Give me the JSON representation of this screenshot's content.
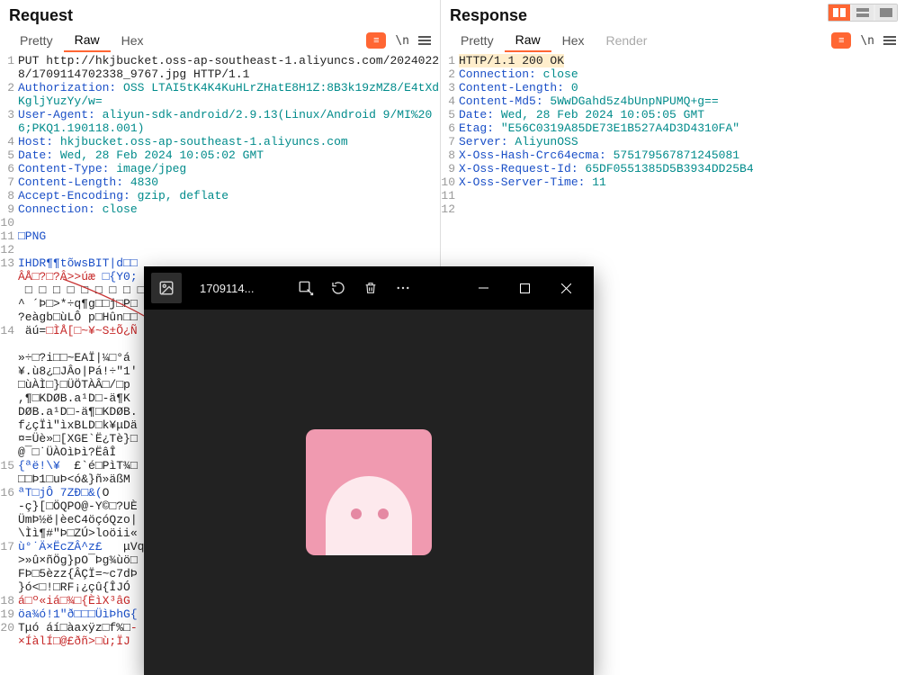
{
  "request": {
    "title": "Request",
    "tabs": {
      "pretty": "Pretty",
      "raw": "Raw",
      "hex": "Hex"
    },
    "nl_icon": "\\n",
    "lines": [
      {
        "n": "1",
        "segs": [
          {
            "t": "PUT ",
            "c": "k-dark"
          },
          {
            "t": "http://hkjbucket.oss-ap-southeast-1.aliyuncs.com/20240228/1709114702338_9767.jpg HTTP/1.1",
            "c": "k-dark",
            "wrap": true
          }
        ]
      },
      {
        "n": "2",
        "segs": [
          {
            "t": "Authorization:",
            "c": "k-blue"
          },
          {
            "t": " OSS LTAI5tK4K4KuHLrZHatE8H1Z:8B3k19zMZ8/E4tXdKgljYuzYy/w=",
            "c": "k-teal",
            "wrap": true
          }
        ]
      },
      {
        "n": "3",
        "segs": [
          {
            "t": "User-Agent:",
            "c": "k-blue"
          },
          {
            "t": " aliyun-sdk-android/2.9.13(Linux/Android 9/MI%206;PKQ1.190118.001)",
            "c": "k-teal",
            "wrap": true
          }
        ]
      },
      {
        "n": "4",
        "segs": [
          {
            "t": "Host:",
            "c": "k-blue"
          },
          {
            "t": " hkjbucket.oss-ap-southeast-1.aliyuncs.com",
            "c": "k-teal"
          }
        ]
      },
      {
        "n": "5",
        "segs": [
          {
            "t": "Date:",
            "c": "k-blue"
          },
          {
            "t": " Wed, 28 Feb 2024 10:05:02 GMT",
            "c": "k-teal"
          }
        ]
      },
      {
        "n": "6",
        "segs": [
          {
            "t": "Content-Type:",
            "c": "k-blue"
          },
          {
            "t": " image/jpeg",
            "c": "k-teal"
          }
        ]
      },
      {
        "n": "7",
        "segs": [
          {
            "t": "Content-Length:",
            "c": "k-blue"
          },
          {
            "t": " 4830",
            "c": "k-teal"
          }
        ]
      },
      {
        "n": "8",
        "segs": [
          {
            "t": "Accept-Encoding:",
            "c": "k-blue"
          },
          {
            "t": " gzip, deflate",
            "c": "k-teal"
          }
        ]
      },
      {
        "n": "9",
        "segs": [
          {
            "t": "Connection:",
            "c": "k-blue"
          },
          {
            "t": " close",
            "c": "k-teal"
          }
        ]
      },
      {
        "n": "10",
        "segs": [
          {
            "t": "",
            "c": ""
          }
        ]
      },
      {
        "n": "11",
        "segs": [
          {
            "t": "□PNG",
            "c": "k-blue"
          }
        ]
      },
      {
        "n": "12",
        "segs": [
          {
            "t": "",
            "c": ""
          }
        ]
      },
      {
        "n": "13",
        "segs": [
          {
            "t": "IHDR¶¶tõwsBIT|d□□",
            "c": "k-blue"
          },
          {
            "t": "\nÂÅ□?□?Â>>úæ ",
            "c": "k-red"
          },
          {
            "t": "□{Y0;",
            "c": "k-blue"
          },
          {
            "t": "\n □ □ □ □ □ □ □ □ □\n^ ´Þ□>*÷q¶g□□j□P□\n?eàgb□ùLÔ p□Hûn□□",
            "c": "k-dark"
          }
        ],
        "wrap": true
      },
      {
        "n": "14",
        "segs": [
          {
            "t": " äú=",
            "c": "k-dark"
          },
          {
            "t": "□ÌÅ[□~¥~S±Õ¿Ñ",
            "c": "k-red"
          },
          {
            "t": "\n\n»÷□?i□□~EAÏ|¼□°á\n¥.ù8¿□JÂo|Pá!÷\"1'\n□ùÀÌ□}□ÜÖTÀÂ□/□p\n,¶□KDØB.a¹D□-ä¶K\nDØB.a¹D□-ä¶□KDØB.\nf¿çÏì\"ìxBLD□k¥μDä\n¤=Üè»□[XGE`Ë¿Tè}□\n@¯□˙ÜÀOìÞì?ËâÎ",
            "c": "k-dark"
          }
        ],
        "wrap": true
      },
      {
        "n": "15",
        "segs": [
          {
            "t": "{ªë!\\¥",
            "c": "k-blue"
          },
          {
            "t": "  £`é□PìT¾□\n□□Þ1□uÞ<ó&}ñ»äßM",
            "c": "k-dark"
          }
        ],
        "wrap": true
      },
      {
        "n": "16",
        "segs": [
          {
            "t": "ªT□jÔ 7ZÐ□&(",
            "c": "k-blue"
          },
          {
            "t": "O\n-ç}[□ÖQPO@-Y©□?UÈ\nÜmÞ½ë|èeC4öçóQzo|\n\\Ìì¶#\"Þ□ZÚ>loöii«",
            "c": "k-dark"
          }
        ],
        "wrap": true
      },
      {
        "n": "17",
        "segs": [
          {
            "t": "ù°˙Ä×ËcZÂ^z£",
            "c": "k-blue"
          },
          {
            "t": "   μVq\n>»û×ñÖg}pO¯Þg¾ùö□\nFÞ□5èzz{ÂÇÏ=~c7dÞ\n}ó<□!□RF¡¿çû{ÎJÓ",
            "c": "k-dark"
          }
        ],
        "wrap": true
      },
      {
        "n": "18",
        "segs": [
          {
            "t": "á□º«iá□¾□{ÈìX³âG",
            "c": "k-red"
          }
        ]
      },
      {
        "n": "19",
        "segs": [
          {
            "t": "öa¾ó!1\"ð□□□ÜìÞhG{",
            "c": "k-blue"
          }
        ]
      },
      {
        "n": "20",
        "segs": [
          {
            "t": "Tμó áí□àaxÿz□f%□",
            "c": "k-dark"
          },
          {
            "t": "-\n×ÍàlÍ□@£ðñ>□ù;ÏJ",
            "c": "k-red"
          }
        ],
        "wrap": true
      }
    ]
  },
  "response": {
    "title": "Response",
    "tabs": {
      "pretty": "Pretty",
      "raw": "Raw",
      "hex": "Hex",
      "render": "Render"
    },
    "nl_icon": "\\n",
    "lines": [
      {
        "n": "1",
        "segs": [
          {
            "t": "HTTP/1.1 200 OK",
            "c": "k-dark",
            "sel": true
          }
        ]
      },
      {
        "n": "2",
        "segs": [
          {
            "t": "Connection:",
            "c": "k-blue"
          },
          {
            "t": " close",
            "c": "k-teal"
          }
        ]
      },
      {
        "n": "3",
        "segs": [
          {
            "t": "Content-Length:",
            "c": "k-blue"
          },
          {
            "t": " 0",
            "c": "k-teal"
          }
        ]
      },
      {
        "n": "4",
        "segs": [
          {
            "t": "Content-Md5:",
            "c": "k-blue"
          },
          {
            "t": " 5WwDGahd5z4bUnpNPUMQ+g==",
            "c": "k-teal"
          }
        ]
      },
      {
        "n": "5",
        "segs": [
          {
            "t": "Date:",
            "c": "k-blue"
          },
          {
            "t": " Wed, 28 Feb 2024 10:05:05 GMT",
            "c": "k-teal"
          }
        ]
      },
      {
        "n": "6",
        "segs": [
          {
            "t": "Etag:",
            "c": "k-blue"
          },
          {
            "t": " \"E56C0319A85DE73E1B527A4D3D4310FA\"",
            "c": "k-teal"
          }
        ]
      },
      {
        "n": "7",
        "segs": [
          {
            "t": "Server:",
            "c": "k-blue"
          },
          {
            "t": " AliyunOSS",
            "c": "k-teal"
          }
        ]
      },
      {
        "n": "8",
        "segs": [
          {
            "t": "X-Oss-Hash-Crc64ecma:",
            "c": "k-blue"
          },
          {
            "t": " 575179567871245081",
            "c": "k-teal"
          }
        ]
      },
      {
        "n": "9",
        "segs": [
          {
            "t": "X-Oss-Request-Id:",
            "c": "k-blue"
          },
          {
            "t": " 65DF0551385D5B3934DD25B4",
            "c": "k-teal"
          }
        ]
      },
      {
        "n": "10",
        "segs": [
          {
            "t": "X-Oss-Server-Time:",
            "c": "k-blue"
          },
          {
            "t": " 11",
            "c": "k-teal"
          }
        ]
      },
      {
        "n": "11",
        "segs": [
          {
            "t": "",
            "c": ""
          }
        ]
      },
      {
        "n": "12",
        "segs": [
          {
            "t": "",
            "c": ""
          }
        ]
      }
    ]
  },
  "viewer": {
    "title": "1709114..."
  }
}
